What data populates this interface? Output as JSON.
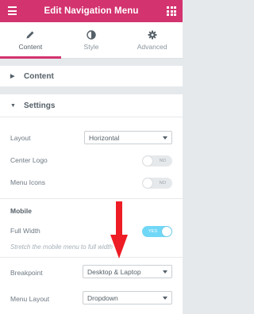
{
  "header": {
    "title": "Edit Navigation Menu",
    "menu_icon": "hamburger-icon",
    "grid_icon": "apps-grid-icon"
  },
  "tabs": [
    {
      "label": "Content",
      "icon": "pencil-icon",
      "active": true
    },
    {
      "label": "Style",
      "icon": "contrast-icon",
      "active": false
    },
    {
      "label": "Advanced",
      "icon": "gear-icon",
      "active": false
    }
  ],
  "sections": {
    "content": {
      "label": "Content",
      "expanded": false
    },
    "settings": {
      "label": "Settings",
      "expanded": true
    }
  },
  "settings": {
    "layout": {
      "label": "Layout",
      "value": "Horizontal"
    },
    "center_logo": {
      "label": "Center Logo",
      "toggle": "NO"
    },
    "menu_icons": {
      "label": "Menu Icons",
      "toggle": "NO"
    },
    "mobile_heading": "Mobile",
    "full_width": {
      "label": "Full Width",
      "toggle": "YES",
      "help": "Stretch the mobile menu to full width"
    },
    "breakpoint": {
      "label": "Breakpoint",
      "value": "Desktop & Laptop"
    },
    "menu_layout": {
      "label": "Menu Layout",
      "value": "Dropdown"
    }
  },
  "colors": {
    "brand": "#d3336f",
    "toggle_on": "#71d7f7",
    "annotation_arrow": "#ee1c24"
  }
}
